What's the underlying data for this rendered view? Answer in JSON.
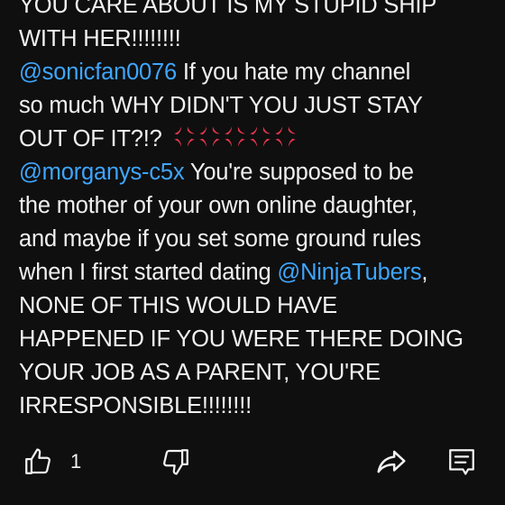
{
  "comment": {
    "line1": "YOU CARE ABOUT IS MY STUPID SHIP",
    "line2": "WITH HER!!!!!!!!",
    "reply1": {
      "mention": "@sonicfan0076",
      "line1_text": " If you hate my channel",
      "line2": "so much WHY DIDN'T YOU JUST STAY",
      "line3": "OUT OF IT?!? ",
      "emoji": "anger-symbol-icon",
      "emoji_count": 5
    },
    "reply2": {
      "mention": "@morganys-c5x",
      "line1_text": " You're supposed to be",
      "line2": "the mother of your own online daughter,",
      "line3": "and maybe if you set some ground rules",
      "line4_text": "when I first started dating ",
      "line4_mention": "@NinjaTubers",
      "line4_after": ",",
      "line5": "NONE OF THIS WOULD HAVE",
      "line6": "HAPPENED IF YOU WERE THERE DOING",
      "line7": "YOUR JOB AS A PARENT, YOU'RE",
      "line8": "IRRESPONSIBLE!!!!!!!!"
    }
  },
  "actions": {
    "like_icon": "thumbs-up-icon",
    "like_count": "1",
    "dislike_icon": "thumbs-down-icon",
    "share_icon": "share-icon",
    "reply_icon": "reply-comment-icon"
  },
  "colors": {
    "background": "#0f0f0f",
    "text": "#f1f1f1",
    "mention": "#3ea6ff",
    "emoji": "#e8384f"
  }
}
